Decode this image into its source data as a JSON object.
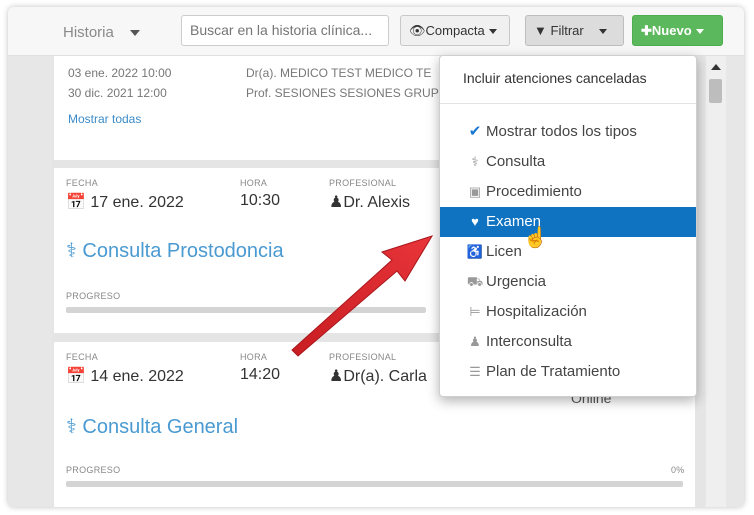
{
  "toolbar": {
    "history_label": "Historia",
    "search_placeholder": "Buscar en la historia clínica...",
    "compact_label": "Compacta",
    "filter_label": "Filtrar",
    "new_label": "Nuevo"
  },
  "top_card": {
    "lines": [
      "03 ene. 2022 10:00",
      "30 dic. 2021 12:00"
    ],
    "profs": [
      "Dr(a). MEDICO TEST MEDICO TE",
      "Prof. SESIONES SESIONES GRUP"
    ],
    "show_all": "Mostrar todas"
  },
  "cards": [
    {
      "fecha_label": "FECHA",
      "fecha": "17 ene. 2022",
      "hora_label": "HORA",
      "hora": "10:30",
      "prof_label": "PROFESIONAL",
      "prof": "Dr. Alexis",
      "title": "Consulta Prostodoncia",
      "progress_label": "PROGRESO"
    },
    {
      "fecha_label": "FECHA",
      "fecha": "14 ene. 2022",
      "hora_label": "HORA",
      "hora": "14:20",
      "prof_label": "PROFESIONAL",
      "prof": "Dr(a). Carla",
      "title": "Consulta General",
      "progress_label": "PROGRESO",
      "progress_value": "0%",
      "mode": "Online"
    }
  ],
  "filter_menu": {
    "header": "Incluir atenciones canceladas",
    "items": [
      {
        "label": "Mostrar todos los tipos",
        "icon": "check-icon"
      },
      {
        "label": "Consulta",
        "icon": "stethoscope-icon"
      },
      {
        "label": "Procedimiento",
        "icon": "camera-icon"
      },
      {
        "label": "Examen",
        "icon": "heartbeat-icon",
        "active": true
      },
      {
        "label": "Licen",
        "icon": "wheelchair-icon"
      },
      {
        "label": "Urgencia",
        "icon": "ambulance-icon"
      },
      {
        "label": "Hospitalización",
        "icon": "bed-icon"
      },
      {
        "label": "Interconsulta",
        "icon": "user-md-icon"
      },
      {
        "label": "Plan de Tratamiento",
        "icon": "list-icon"
      }
    ]
  },
  "colors": {
    "accent": "#4a9ad2",
    "active_item": "#0f73c1",
    "new_button": "#5cb85c",
    "arrow": "#d9232a"
  }
}
